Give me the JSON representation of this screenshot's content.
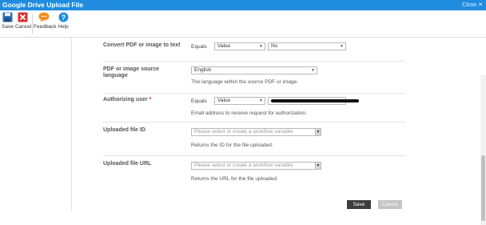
{
  "window": {
    "title": "Google Drive Upload File",
    "close_label": "Close"
  },
  "ribbon": {
    "buttons": [
      {
        "label": "Save",
        "icon": "save-icon"
      },
      {
        "label": "Cancel",
        "icon": "cancel-icon"
      },
      {
        "label": "Feedback",
        "icon": "feedback-icon"
      },
      {
        "label": "Help",
        "icon": "help-icon"
      }
    ]
  },
  "colors": {
    "titlebar": "#1f8ce0",
    "required": "#d9251c",
    "save_button": "#3d3d3d",
    "cancel_button": "#c4c4c4"
  },
  "form": {
    "convert": {
      "label": "Convert PDF or image to text",
      "operator": "Equals",
      "type_value": "Value",
      "value": "No"
    },
    "source_language": {
      "label": "PDF or image source language",
      "value": "English",
      "help": "The language within the source PDF or image."
    },
    "authorizing_user": {
      "label": "Authorizing user",
      "required_mark": "*",
      "operator": "Equals",
      "type_value": "Value",
      "help": "Email address to receive request for authorization."
    },
    "uploaded_file_id": {
      "label": "Uploaded file ID",
      "placeholder": "Please select or create a workflow variable",
      "help": "Returns the ID for the file uploaded."
    },
    "uploaded_file_url": {
      "label": "Uploaded file URL",
      "placeholder": "Please select or create a workflow variable",
      "help": "Returns the URL for the file uploaded."
    }
  },
  "footer": {
    "save_label": "Save",
    "cancel_label": "Cancel"
  }
}
